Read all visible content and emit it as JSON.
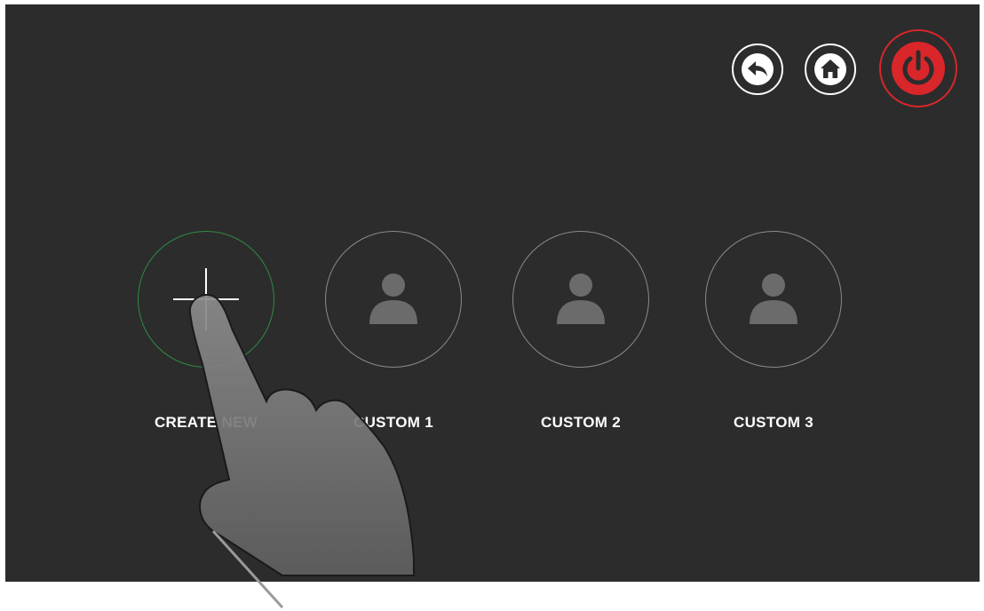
{
  "header": {
    "controls": [
      {
        "name": "back",
        "icon": "back-arrow-icon",
        "color": "#ffffff"
      },
      {
        "name": "home",
        "icon": "home-icon",
        "color": "#ffffff"
      },
      {
        "name": "power",
        "icon": "power-icon",
        "color": "#d8262b"
      }
    ]
  },
  "profiles": [
    {
      "label": "CREATE NEW",
      "icon": "plus-icon",
      "ring_color": "#2f8a44"
    },
    {
      "label": "CUSTOM 1",
      "icon": "user-icon",
      "ring_color": "#8a8a8a"
    },
    {
      "label": "CUSTOM 2",
      "icon": "user-icon",
      "ring_color": "#8a8a8a"
    },
    {
      "label": "CUSTOM 3",
      "icon": "user-icon",
      "ring_color": "#8a8a8a"
    }
  ],
  "overlay": {
    "icon": "pointing-hand-icon"
  },
  "colors": {
    "background": "#2c2c2c",
    "accent_green": "#2f8a44",
    "power_red": "#d8262b"
  }
}
